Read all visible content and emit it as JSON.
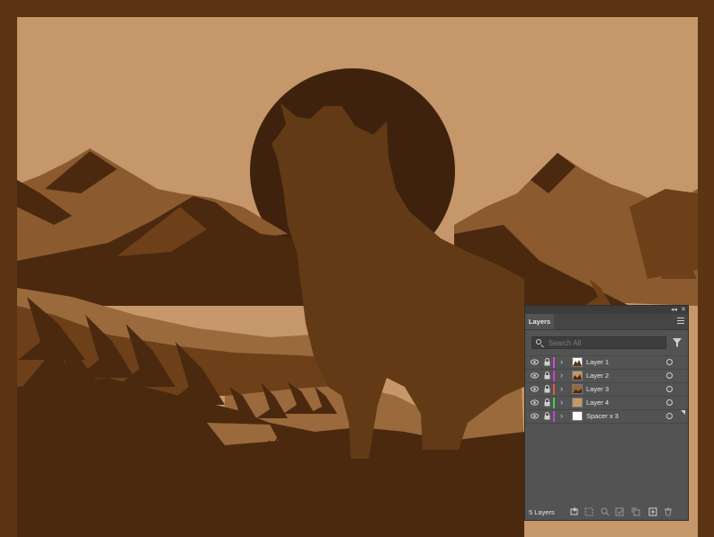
{
  "artwork": {
    "colors": {
      "frame": "#5b3413",
      "sky": "#c5976a",
      "moon": "#3f220d",
      "far_mountain": "#8b5a2f",
      "mountain_dark": "#4a290f",
      "ridge": "#6d4019",
      "slope_light": "#9a6a3c",
      "wolf": "#623b16"
    }
  },
  "panel": {
    "tab_label": "Layers",
    "search_placeholder": "Search All",
    "layers": [
      {
        "name": "Layer 1",
        "color": "#c94bd8",
        "thumb": "scene"
      },
      {
        "name": "Layer 2",
        "color": "#d63ad6",
        "thumb": "scene"
      },
      {
        "name": "Layer 3",
        "color": "#e05a4b",
        "thumb": "scene"
      },
      {
        "name": "Layer 4",
        "color": "#3fd04a",
        "thumb": "tan"
      },
      {
        "name": "Spacer x 3",
        "color": "#b94ad8",
        "thumb": "blank"
      }
    ],
    "footer_count": "5 Layers",
    "icons": [
      "collapse-panel-icon",
      "close-panel-icon",
      "panel-menu-icon",
      "search-icon",
      "filter-icon",
      "visibility-eye-icon",
      "lock-icon",
      "expand-chevron-icon",
      "target-circle-icon",
      "collect-for-export-icon",
      "make-clipping-mask-icon",
      "locate-object-icon",
      "create-sublayer-icon",
      "create-new-layer-icon",
      "delete-layer-icon"
    ]
  }
}
